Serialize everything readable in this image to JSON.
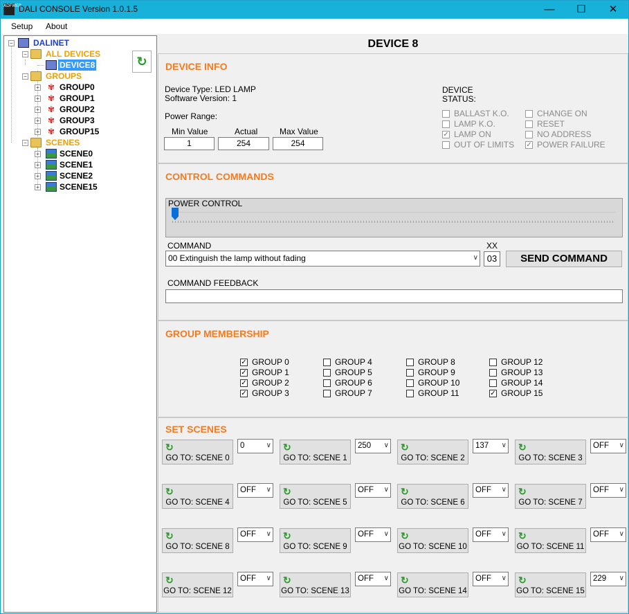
{
  "window": {
    "title": "DALI CONSOLE Version 1.0.1.5",
    "logo_text": "ADFWEB",
    "minimize": "—",
    "maximize": "☐",
    "close": "✕"
  },
  "menu": [
    "Setup",
    "About"
  ],
  "tree": {
    "root": "DALINET",
    "all_devices": "ALL DEVICES",
    "device": "DEVICE8",
    "groups_label": "GROUPS",
    "groups": [
      "GROUP0",
      "GROUP1",
      "GROUP2",
      "GROUP3",
      "GROUP15"
    ],
    "scenes_label": "SCENES",
    "scenes": [
      "SCENE0",
      "SCENE1",
      "SCENE2",
      "SCENE15"
    ]
  },
  "refresh_icon": "↻",
  "device_title": "DEVICE 8",
  "device_info": {
    "title": "DEVICE INFO",
    "device_type": "Device Type:  LED LAMP",
    "software_version": "Software Version: 1",
    "power_range_label": "Power Range:",
    "min_label": "Min Value",
    "min_value": "1",
    "actual_label": "Actual",
    "actual_value": "254",
    "max_label": "Max Value",
    "max_value": "254",
    "status_label_1": "DEVICE",
    "status_label_2": "STATUS:",
    "status_left": [
      {
        "label": "BALLAST K.O.",
        "checked": false
      },
      {
        "label": "LAMP K.O.",
        "checked": false
      },
      {
        "label": "LAMP ON",
        "checked": true
      },
      {
        "label": "OUT OF LIMITS",
        "checked": false
      }
    ],
    "status_right": [
      {
        "label": "CHANGE ON",
        "checked": false
      },
      {
        "label": "RESET",
        "checked": false
      },
      {
        "label": "NO ADDRESS",
        "checked": false
      },
      {
        "label": "POWER FAILURE",
        "checked": true
      }
    ]
  },
  "control": {
    "title": "CONTROL COMMANDS",
    "power_control_label": "POWER CONTROL",
    "power_level": 0,
    "command_label": "COMMAND",
    "command_value": "00 Extinguish the lamp without fading",
    "xx_label": "XX",
    "xx_value": "03",
    "send_label": "SEND COMMAND",
    "feedback_label": "COMMAND FEEDBACK",
    "feedback_value": ""
  },
  "membership": {
    "title": "GROUP MEMBERSHIP",
    "columns": [
      [
        {
          "label": "GROUP 0",
          "checked": true
        },
        {
          "label": "GROUP 1",
          "checked": true
        },
        {
          "label": "GROUP 2",
          "checked": true
        },
        {
          "label": "GROUP 3",
          "checked": true
        }
      ],
      [
        {
          "label": "GROUP 4",
          "checked": false
        },
        {
          "label": "GROUP 5",
          "checked": false
        },
        {
          "label": "GROUP 6",
          "checked": false
        },
        {
          "label": "GROUP 7",
          "checked": false
        }
      ],
      [
        {
          "label": "GROUP 8",
          "checked": false
        },
        {
          "label": "GROUP 9",
          "checked": false
        },
        {
          "label": "GROUP 10",
          "checked": false
        },
        {
          "label": "GROUP 11",
          "checked": false
        }
      ],
      [
        {
          "label": "GROUP 12",
          "checked": false
        },
        {
          "label": "GROUP 13",
          "checked": false
        },
        {
          "label": "GROUP 14",
          "checked": false
        },
        {
          "label": "GROUP 15",
          "checked": true
        }
      ]
    ]
  },
  "scenes": {
    "title": "SET SCENES",
    "items": [
      {
        "label": "GO TO: SCENE 0",
        "value": "0"
      },
      {
        "label": "GO TO: SCENE 1",
        "value": "250"
      },
      {
        "label": "GO TO: SCENE 2",
        "value": "137"
      },
      {
        "label": "GO TO: SCENE 3",
        "value": "OFF"
      },
      {
        "label": "GO TO: SCENE 4",
        "value": "OFF"
      },
      {
        "label": "GO TO: SCENE 5",
        "value": "OFF"
      },
      {
        "label": "GO TO: SCENE 6",
        "value": "OFF"
      },
      {
        "label": "GO TO: SCENE 7",
        "value": "OFF"
      },
      {
        "label": "GO TO: SCENE 8",
        "value": "OFF"
      },
      {
        "label": "GO TO: SCENE 9",
        "value": "OFF"
      },
      {
        "label": "GO TO: SCENE 10",
        "value": "OFF"
      },
      {
        "label": "GO TO: SCENE 11",
        "value": "OFF"
      },
      {
        "label": "GO TO: SCENE 12",
        "value": "OFF"
      },
      {
        "label": "GO TO: SCENE 13",
        "value": "OFF"
      },
      {
        "label": "GO TO: SCENE 14",
        "value": "OFF"
      },
      {
        "label": "GO TO: SCENE 15",
        "value": "229"
      }
    ]
  },
  "colors": {
    "titlebar": "#17b1d9",
    "accent": "#f47b20",
    "tree_root": "#1a3fd6",
    "tree_folder": "#f0a000",
    "selection": "#3399ff"
  }
}
